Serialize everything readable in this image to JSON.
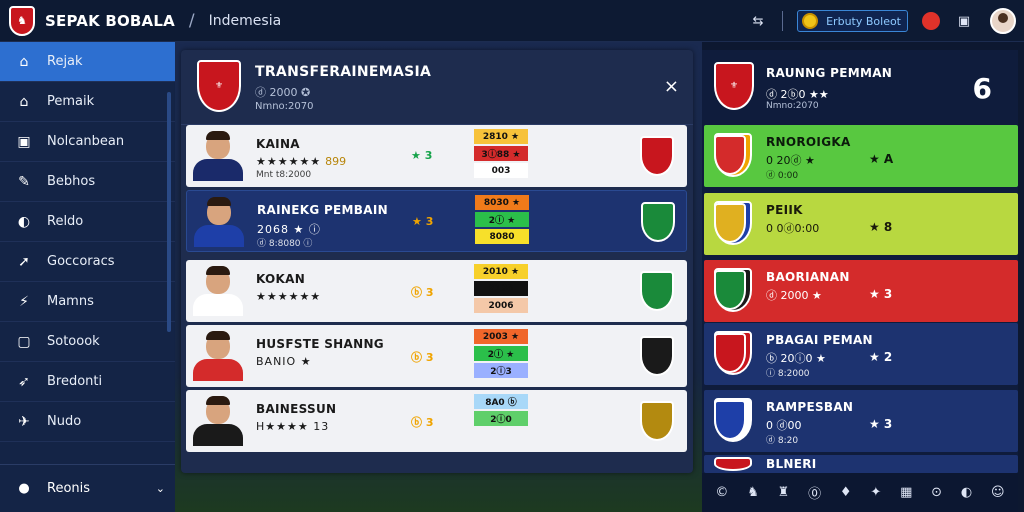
{
  "header": {
    "brand": "SEPAK BOBALA",
    "breadcrumb": "Indemesia",
    "balance_label": "Erbuty Boleot",
    "icons": [
      "share-icon",
      "more-vertical-icon",
      "coin-icon",
      "notification-icon",
      "window-icon",
      "avatar"
    ]
  },
  "sidebar": {
    "items": [
      {
        "label": "Rejak",
        "icon": "⌂",
        "icon_name": "home-icon",
        "active": true
      },
      {
        "label": "Pemaik",
        "icon": "⌂",
        "icon_name": "house-icon"
      },
      {
        "label": "Nolcanbean",
        "icon": "▣",
        "icon_name": "grid-icon"
      },
      {
        "label": "Bebhos",
        "icon": "✎",
        "icon_name": "edit-icon"
      },
      {
        "label": "Reldo",
        "icon": "◐",
        "icon_name": "circle-icon"
      },
      {
        "label": "Goccoracs",
        "icon": "➚",
        "icon_name": "arrow-icon"
      },
      {
        "label": "Mamns",
        "icon": "⚡",
        "icon_name": "bolt-icon"
      },
      {
        "label": "Sotoook",
        "icon": "▢",
        "icon_name": "book-icon"
      },
      {
        "label": "Bredonti",
        "icon": "➶",
        "icon_name": "send-icon"
      },
      {
        "label": "Nudo",
        "icon": "✈",
        "icon_name": "plane-icon"
      }
    ],
    "footer_label": "Reonis",
    "footer_icon": "●"
  },
  "transfer_panel": {
    "title": "TRANSFERAINEMASIA",
    "subtitle": "ⓓ 2000 ✪",
    "subtitle2": "Nmno:2070",
    "close": "×",
    "rows": [
      {
        "name": "KAINA",
        "stars": "★★★★★★",
        "rating": "899",
        "track": "Mnt t8:2000",
        "badge": "★ 3",
        "badge_class": "gs",
        "bars": [
          {
            "t": "2810 ★",
            "c": "#f7c23a"
          },
          {
            "t": "3ⓘ88 ★",
            "c": "#d42b2b"
          },
          {
            "t": "003",
            "c": "#ffffff"
          }
        ],
        "theme": "light",
        "kit": "#1a2a6a",
        "club": "#c8161e"
      },
      {
        "name": "RAINEKG PEMBAIN",
        "stars": "2068 ★ ⓘ",
        "rating": "",
        "track": "ⓓ 8:8080 ⓘ",
        "badge": "★ 3",
        "badge_class": "ys",
        "bars": [
          {
            "t": "8030 ★",
            "c": "#f07a1a"
          },
          {
            "t": "2ⓘ ★",
            "c": "#2bbf4a"
          },
          {
            "t": "8080",
            "c": "#f7e02a"
          }
        ],
        "theme": "dark",
        "kit": "#1e3fa8",
        "club": "#1a8a3a"
      },
      {
        "name": "KOKAN",
        "stars": "★★★★★★",
        "rating": "",
        "track": "",
        "badge": "ⓑ 3",
        "badge_class": "ys",
        "bars": [
          {
            "t": "2010 ★",
            "c": "#f7d02a"
          },
          {
            "t": "2138",
            "c": "#111111"
          },
          {
            "t": "2006",
            "c": "#f4c8a8"
          }
        ],
        "theme": "light",
        "kit": "#ffffff",
        "club": "#1a8a3a"
      },
      {
        "name": "HUSFSTE SHANNG",
        "stars": "BANIO ★",
        "rating": "",
        "track": "",
        "badge": "ⓑ 3",
        "badge_class": "ys",
        "bars": [
          {
            "t": "2003 ★",
            "c": "#f0662a"
          },
          {
            "t": "2ⓘ ★",
            "c": "#2bbf4a"
          },
          {
            "t": "2ⓘ3",
            "c": "#9ab0ff"
          }
        ],
        "theme": "light",
        "kit": "#d42b2b",
        "club": "#1a1a1a"
      },
      {
        "name": "BAINESSUN",
        "stars": "H★★★★ 13",
        "rating": "",
        "track": "",
        "badge": "ⓑ 3",
        "badge_class": "ys",
        "bars": [
          {
            "t": "8A0 ⓑ",
            "c": "#a8d8f8"
          },
          {
            "t": "2ⓘ0",
            "c": "#5fcf6a"
          }
        ],
        "theme": "light",
        "kit": "#1a1a1a",
        "club": "#b38a10"
      }
    ]
  },
  "ranking_panel": {
    "title": "RAUNNG PEMMAN",
    "sub": "ⓓ 2ⓑ0 ★★",
    "sub2": "Nmno:2070",
    "count": "6",
    "rows": [
      {
        "name": "RNOROIGKA",
        "line": "0 20ⓓ ★",
        "track": "ⓓ 0:00",
        "rating": "★ A",
        "bg": "#58c840",
        "fg": "#0b1a0b",
        "crest": "#f0a400",
        "crest2": "#d42b2b"
      },
      {
        "name": "PEIIK",
        "line": "0 0ⓓ0:00",
        "track": "",
        "rating": "★ 8",
        "bg": "#b8d840",
        "fg": "#1a1a0b",
        "crest": "#1e3fa8",
        "crest2": "#e0b020"
      },
      {
        "name": "BAORIANAN",
        "line": "ⓓ 2000 ★",
        "track": "",
        "rating": "★ 3",
        "bg": "#d42b2b",
        "fg": "#ffffff",
        "crest": "#1a1a1a",
        "crest2": "#1a8a3a"
      },
      {
        "name": "PBAGAI PEMAN",
        "line": "ⓑ 20ⓘ0 ★",
        "track": "ⓘ 8:2000",
        "rating": "★ 2",
        "bg": "#1d3370",
        "fg": "#ffffff",
        "crest": "#c8161e",
        "crest2": "#c8161e"
      },
      {
        "name": "RAMPESBAN",
        "line": "0 ⓓ00",
        "track": "ⓓ 8:20",
        "rating": "★ 3",
        "bg": "#1d3370",
        "fg": "#ffffff",
        "crest": "#ffffff",
        "crest2": "#1e3fa8"
      },
      {
        "name": "BLNERI",
        "line": "",
        "track": "",
        "rating": "",
        "bg": "#1d3370",
        "fg": "#ffffff",
        "crest": "#c8161e",
        "crest2": "#c8161e"
      }
    ]
  },
  "bottom_bar": {
    "icons": [
      {
        "label": "©",
        "name": "info-icon"
      },
      {
        "label": "♞",
        "name": "knight-icon"
      },
      {
        "label": "♜",
        "name": "trophy-icon"
      },
      {
        "label": "⓪",
        "name": "badge-icon"
      },
      {
        "label": "♦",
        "name": "gem-icon"
      },
      {
        "label": "✦",
        "name": "spark-icon"
      },
      {
        "label": "▦",
        "name": "cube-icon"
      },
      {
        "label": "⊙",
        "name": "target-icon"
      },
      {
        "label": "◐",
        "name": "toggle-icon"
      },
      {
        "label": "☺",
        "name": "mascot-icon"
      }
    ]
  },
  "colors": {
    "accent": "#2d6fd0",
    "brand_red": "#c8161e",
    "bg": "#0d1830"
  }
}
